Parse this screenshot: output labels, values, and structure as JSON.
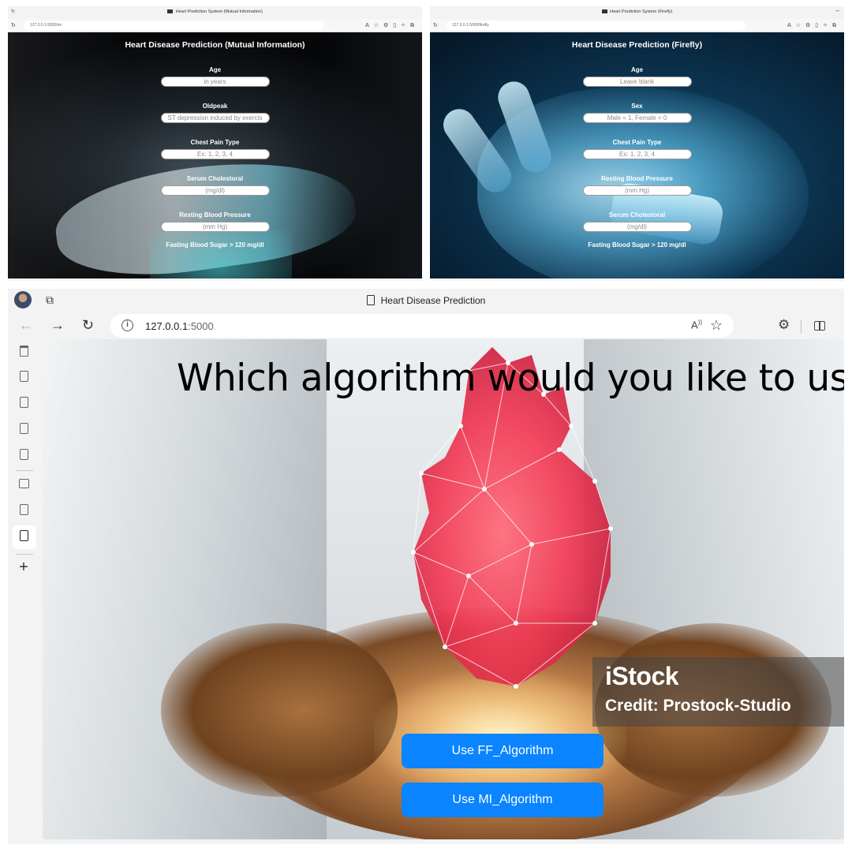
{
  "windows": {
    "mutual_info": {
      "tab_title": "Heart Prediction System (Mutual Information)",
      "url": "127.0.0.1:5000/mi",
      "form": {
        "title": "Heart Disease Prediction (Mutual Information)",
        "fields": [
          {
            "label": "Age",
            "placeholder": "in years"
          },
          {
            "label": "Oldpeak",
            "placeholder": "ST depression induced by exercis"
          },
          {
            "label": "Chest Pain Type",
            "placeholder": "Ex: 1, 2, 3, 4"
          },
          {
            "label": "Serum Cholestoral",
            "placeholder": "(mg/dl)"
          },
          {
            "label": "Resting Blood Pressure",
            "placeholder": "(mm Hg)"
          },
          {
            "label": "Fasting Blood Sugar > 120 mg/dl",
            "placeholder": ""
          }
        ]
      }
    },
    "firefly": {
      "tab_title": "Heart Prediction System (Firefly)",
      "url": "127.0.0.1:5000/firefly",
      "form": {
        "title": "Heart Disease Prediction (Firefly)",
        "fields": [
          {
            "label": "Age",
            "placeholder": "Leave blank"
          },
          {
            "label": "Sex",
            "placeholder": "Male = 1, Female = 0"
          },
          {
            "label": "Chest Pain Type",
            "placeholder": "Ex: 1, 2, 3, 4"
          },
          {
            "label": "Resting Blood Pressure",
            "placeholder": "(mm Hg)"
          },
          {
            "label": "Serum Cholestoral",
            "placeholder": "(mg/dl)"
          },
          {
            "label": "Fasting Blood Sugar > 120 mg/dl",
            "placeholder": ""
          }
        ]
      }
    },
    "main": {
      "tab_title": "Heart Disease Prediction",
      "url_host": "127.0.0.1",
      "url_port": ":5000",
      "heading": "Which algorithm would you like to use?",
      "buttons": {
        "ff": "Use FF_Algorithm",
        "mi": "Use MI_Algorithm"
      },
      "watermark": {
        "brand": "iStock",
        "credit": "Credit: Prostock-Studio"
      },
      "button_color": "#0a84ff"
    }
  },
  "icons": {
    "read_aloud": "A⁾",
    "favorite": "☆",
    "extensions": "⚙",
    "add": "+"
  }
}
